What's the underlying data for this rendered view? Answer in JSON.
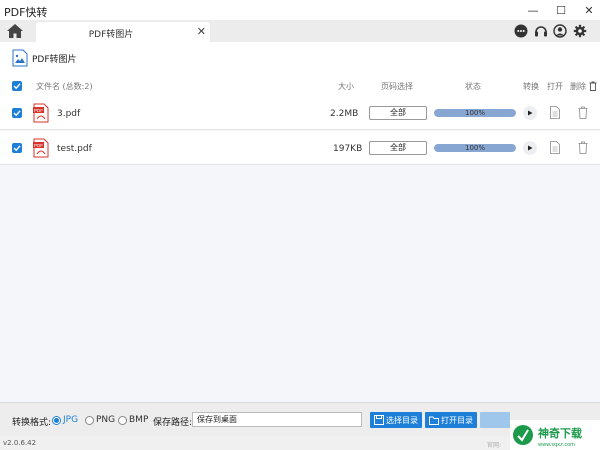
{
  "window": {
    "title": "PDF快转"
  },
  "tabs": [
    {
      "label": "PDF转图片"
    }
  ],
  "page": {
    "title": "PDF转图片"
  },
  "table": {
    "columns": {
      "name": "文件名 (总数:2)",
      "size": "大小",
      "pages": "页码选择",
      "status": "状态",
      "convert": "转换",
      "open": "打开",
      "delete": "删除"
    },
    "rows": [
      {
        "name": "3.pdf",
        "size": "2.2MB",
        "page_choice": "全部",
        "progress_text": "100%",
        "progress": 1.0
      },
      {
        "name": "test.pdf",
        "size": "197KB",
        "page_choice": "全部",
        "progress_text": "100%",
        "progress": 1.0
      }
    ]
  },
  "bottom": {
    "format_label": "转换格式:",
    "formats": [
      "JPG",
      "PNG",
      "BMP"
    ],
    "selected_format": "JPG",
    "path_label": "保存路径:",
    "path_value": "保存到桌面",
    "choose_dir": "选择目录",
    "open_dir": "打开目录"
  },
  "status": {
    "version": "v2.0.6.42",
    "tip": "官网:"
  },
  "watermark": {
    "text": "神奇下载",
    "url": "www.sqxz.com"
  },
  "colors": {
    "accent": "#1d7fd8",
    "progress": "#87a6d2",
    "pdf_red": "#d9322b"
  },
  "icons": [
    "home-icon",
    "chat-icon",
    "headset-icon",
    "user-icon",
    "gear-icon",
    "image-file-icon",
    "pdf-file-icon",
    "play-icon",
    "open-file-icon",
    "trash-icon",
    "save-dir-icon",
    "folder-icon"
  ]
}
